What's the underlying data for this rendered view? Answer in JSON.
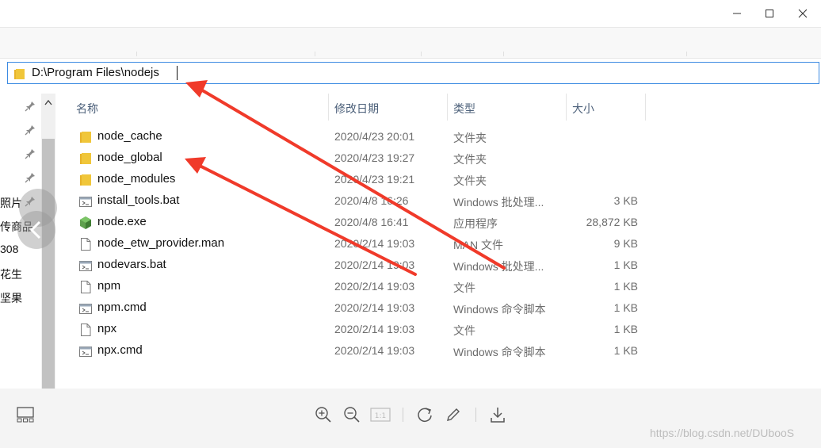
{
  "window": {
    "controls": {
      "minimize": "minimize",
      "maximize": "maximize",
      "close": "close"
    }
  },
  "address": {
    "path": "D:\\Program Files\\nodejs"
  },
  "nav": {
    "labels": [
      "照片",
      "传商品",
      "308",
      "花生",
      "坚果"
    ]
  },
  "columns": {
    "name": "名称",
    "date": "修改日期",
    "type": "类型",
    "size": "大小"
  },
  "files": [
    {
      "name": "node_cache",
      "date": "2020/4/23 20:01",
      "type": "文件夹",
      "size": "",
      "icon": "folder-icon"
    },
    {
      "name": "node_global",
      "date": "2020/4/23 19:27",
      "type": "文件夹",
      "size": "",
      "icon": "folder-icon"
    },
    {
      "name": "node_modules",
      "date": "2020/4/23 19:21",
      "type": "文件夹",
      "size": "",
      "icon": "folder-icon"
    },
    {
      "name": "install_tools.bat",
      "date": "2020/4/8 16:26",
      "type": "Windows 批处理...",
      "size": "3 KB",
      "icon": "batch-file-icon"
    },
    {
      "name": "node.exe",
      "date": "2020/4/8 16:41",
      "type": "应用程序",
      "size": "28,872 KB",
      "icon": "node-exe-icon"
    },
    {
      "name": "node_etw_provider.man",
      "date": "2020/2/14 19:03",
      "type": "MAN 文件",
      "size": "9 KB",
      "icon": "file-icon"
    },
    {
      "name": "nodevars.bat",
      "date": "2020/2/14 19:03",
      "type": "Windows 批处理...",
      "size": "1 KB",
      "icon": "batch-file-icon"
    },
    {
      "name": "npm",
      "date": "2020/2/14 19:03",
      "type": "文件",
      "size": "1 KB",
      "icon": "file-icon"
    },
    {
      "name": "npm.cmd",
      "date": "2020/2/14 19:03",
      "type": "Windows 命令脚本",
      "size": "1 KB",
      "icon": "batch-file-icon"
    },
    {
      "name": "npx",
      "date": "2020/2/14 19:03",
      "type": "文件",
      "size": "1 KB",
      "icon": "file-icon"
    },
    {
      "name": "npx.cmd",
      "date": "2020/2/14 19:03",
      "type": "Windows 命令脚本",
      "size": "1 KB",
      "icon": "batch-file-icon"
    }
  ],
  "viewer": {
    "actual_size_label": "1:1"
  },
  "watermark": "https://blog.csdn.net/DUbooS",
  "colors": {
    "accent": "#3c8be2",
    "arrow": "#f03a2a",
    "folder": "#f0c63a",
    "node_green": "#5fa04e"
  }
}
